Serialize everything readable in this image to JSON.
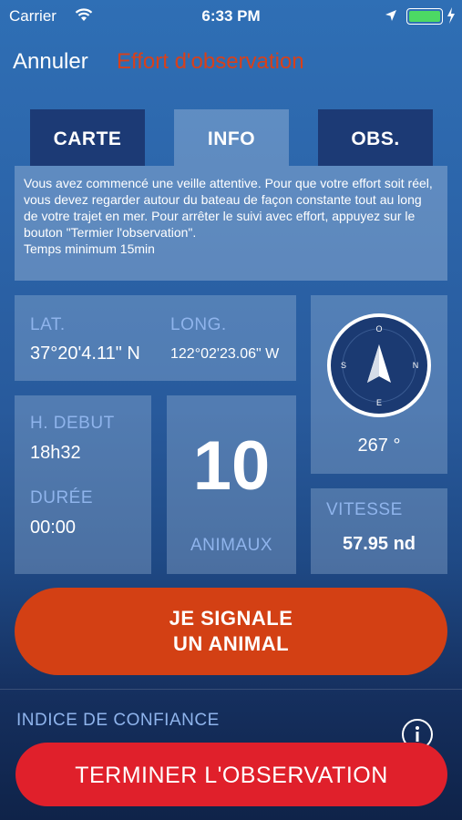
{
  "status_bar": {
    "carrier": "Carrier",
    "time": "6:33 PM",
    "battery_color": "#4cd964"
  },
  "nav": {
    "cancel_label": "Annuler",
    "title": "Effort d'observation",
    "title_color": "#d8401a"
  },
  "tabs": [
    {
      "label": "CARTE",
      "active": false
    },
    {
      "label": "INFO",
      "active": true
    },
    {
      "label": "OBS.",
      "active": false
    }
  ],
  "info_text": "Vous avez commencé une veille attentive. Pour que votre effort soit réel, vous devez regarder autour du bateau de façon constante tout au long de votre trajet en mer. Pour arrêter le suivi avec effort, appuyez sur le bouton \"Termier l'observation\".\nTemps minimum 15min",
  "position": {
    "lat_label": "LAT.",
    "lat_value": "37°20'4.11\" N",
    "long_label": "LONG.",
    "long_value": "122°02'23.06\" W"
  },
  "compass": {
    "heading": "267 °",
    "n": "N",
    "s": "S",
    "e": "E",
    "o": "O"
  },
  "timing": {
    "start_label": "H. DEBUT",
    "start_value": "18h32",
    "duration_label": "DURÉE",
    "duration_value": "00:00"
  },
  "animals": {
    "count": "10",
    "label": "ANIMAUX"
  },
  "speed": {
    "label": "VITESSE",
    "value": "57.95 nd"
  },
  "actions": {
    "signal_line1": "JE SIGNALE",
    "signal_line2": "UN ANIMAL",
    "signal_color": "#d34014",
    "confidence_label": "INDICE DE CONFIANCE",
    "end_label": "TERMINER L'OBSERVATION",
    "end_color": "#e0202b"
  },
  "colors": {
    "accent_label": "#8fb4ec",
    "tab_dark": "#1c3a75"
  }
}
